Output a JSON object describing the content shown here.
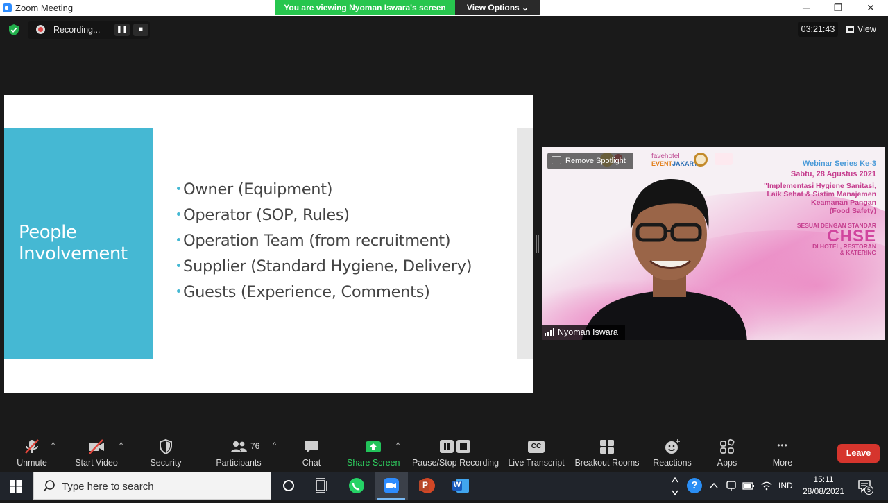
{
  "window": {
    "title": "Zoom Meeting",
    "minimize_glyph": "─",
    "restore_glyph": "❐",
    "close_glyph": "✕"
  },
  "share_banner": {
    "text": "You are viewing Nyoman Iswara's screen",
    "view_options_label": "View Options ⌄",
    "color": "#27c64e"
  },
  "recording": {
    "label": "Recording...",
    "pause_glyph": "❚❚",
    "stop_glyph": "■"
  },
  "top_right": {
    "timer": "03:21:43",
    "view_label": "View"
  },
  "slide": {
    "title": "People Involvement",
    "accent_color": "#45b8d3",
    "bullets": [
      "Owner (Equipment)",
      "Operator (SOP, Rules)",
      "Operation Team (from recruitment)",
      "Supplier (Standard Hygiene, Delivery)",
      "Guests (Experience, Comments)"
    ]
  },
  "video": {
    "remove_spotlight_label": "Remove Spotlight",
    "fave_text": "favehotel",
    "fave_sub": "EVENT",
    "fave_city": "JAKARTA",
    "webinar_series": "Webinar Series Ke-3",
    "date": "Sabtu, 28 Agustus 2021",
    "implementation": "\"Implementasi Hygiene Sanitasi, Laik Sehat & Sistim Manajemen Keamanan Pangan (Food Safety)",
    "impl_line1": "\"Implementasi Hygiene Sanitasi,",
    "impl_line2": "Laik Sehat & Sistim Manajemen",
    "impl_line3": "Keamanan Pangan",
    "impl_line4": "(Food Safety)",
    "sesuai": "SESUAI DENGAN STANDAR",
    "chse": "CHSE",
    "dihotel_line1": "DI HOTEL, RESTORAN",
    "dihotel_line2": "& KATERING",
    "participant_name": "Nyoman Iswara"
  },
  "toolbar": {
    "unmute": "Unmute",
    "start_video": "Start Video",
    "security": "Security",
    "participants": "Participants",
    "participants_count": "76",
    "chat": "Chat",
    "share_screen": "Share Screen",
    "pause_stop_recording": "Pause/Stop Recording",
    "live_transcript": "Live Transcript",
    "cc_glyph": "CC",
    "breakout_rooms": "Breakout Rooms",
    "reactions": "Reactions",
    "apps": "Apps",
    "more": "More",
    "more_glyph": "•••",
    "caret": "^",
    "leave": "Leave"
  },
  "taskbar": {
    "search_placeholder": "Type here to search",
    "powerpoint_letter": "P",
    "word_letter": "W",
    "help_glyph": "?",
    "lang": "IND",
    "time": "15:11",
    "date": "28/08/2021",
    "notification_count": "5"
  }
}
